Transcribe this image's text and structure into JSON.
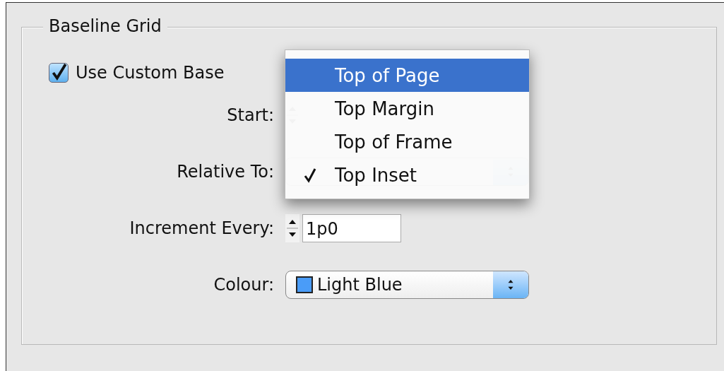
{
  "group": {
    "title": "Baseline Grid"
  },
  "checkbox": {
    "label": "Use Custom Base",
    "checked": true
  },
  "fields": [
    {
      "kind": "stepper",
      "label": "Start:"
    },
    {
      "kind": "popup",
      "label": "Relative To:"
    },
    {
      "kind": "stepper",
      "label": "Increment Every:",
      "value": "1p0"
    },
    {
      "kind": "popup",
      "label": "Colour:",
      "value": "Light Blue",
      "color": "#4a9cf8"
    }
  ],
  "menu": {
    "items": [
      {
        "label": "Top of Page",
        "selected": true,
        "checked": false
      },
      {
        "label": "Top Margin",
        "selected": false,
        "checked": false
      },
      {
        "label": "Top of Frame",
        "selected": false,
        "checked": false
      },
      {
        "label": "Top Inset",
        "selected": false,
        "checked": true
      }
    ]
  }
}
